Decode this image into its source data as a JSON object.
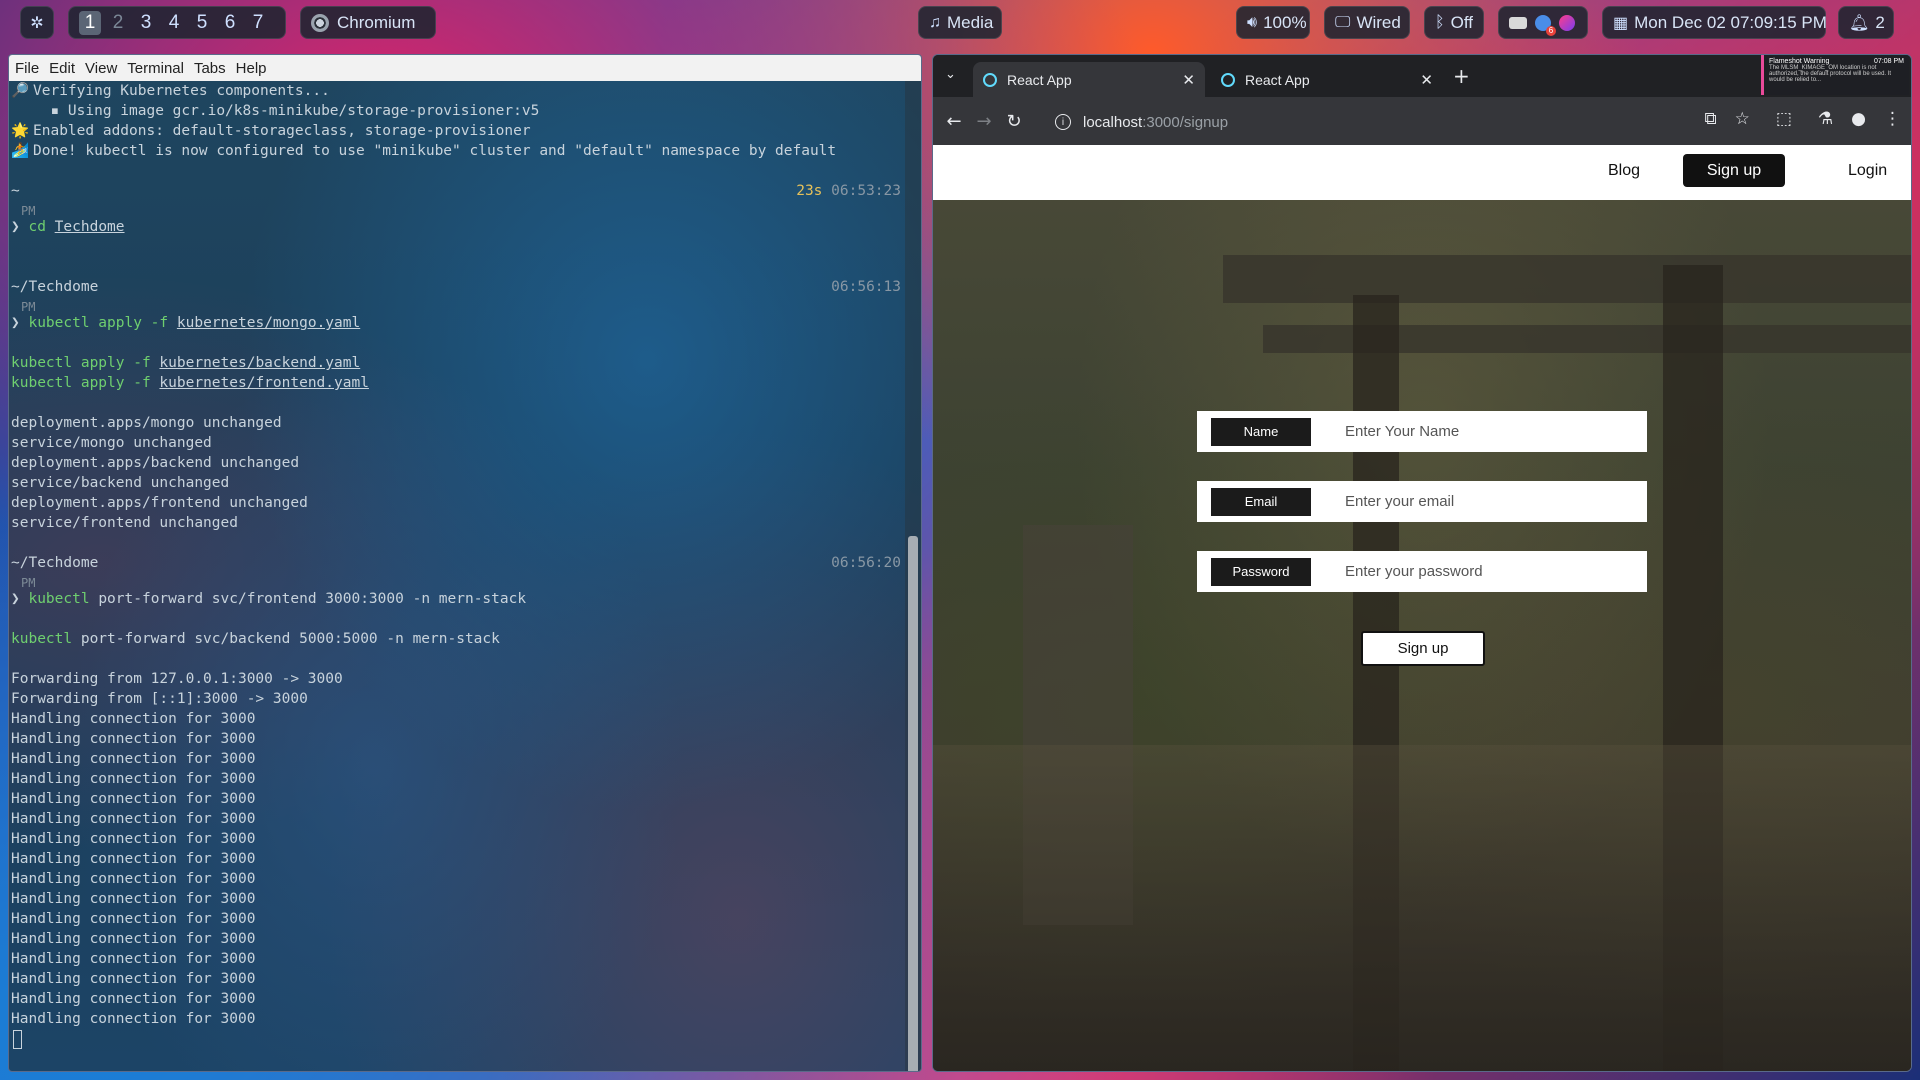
{
  "topbar": {
    "settings_icon": "gear-icon",
    "workspaces": [
      "1",
      "2",
      "3",
      "4",
      "5",
      "6",
      "7"
    ],
    "active_workspace": "1",
    "active_window": "Chromium",
    "media": "Media",
    "volume": "100%",
    "network": "Wired",
    "bluetooth": "Off",
    "datetime": "Mon Dec 02  07:09:15 PM",
    "notifications": "2",
    "tray_badge": "6"
  },
  "terminal": {
    "menu": [
      "File",
      "Edit",
      "View",
      "Terminal",
      "Tabs",
      "Help"
    ],
    "lines": [
      {
        "icon": "🔎",
        "text": "Verifying Kubernetes components..."
      },
      {
        "icon": "",
        "text": "  ▪ Using image gcr.io/k8s-minikube/storage-provisioner:v5"
      },
      {
        "icon": "🌟",
        "text": "Enabled addons: default-storageclass, storage-provisioner"
      },
      {
        "icon": "🏄",
        "text": "Done! kubectl is now configured to use \"minikube\" cluster and \"default\" namespace by default"
      }
    ],
    "prompt1": {
      "dir": "~",
      "duration": "23s",
      "time": "06:53:23",
      "ampm": "PM",
      "cmd": "cd",
      "arg": "Techdome"
    },
    "prompt2": {
      "dir": "~/Techdome",
      "time": "06:56:13",
      "ampm": "PM",
      "cmd": "kubectl apply -f",
      "arg": "kubernetes/mongo.yaml"
    },
    "apply_lines": [
      {
        "cmd": "kubectl apply -f",
        "arg": "kubernetes/backend.yaml"
      },
      {
        "cmd": "kubectl apply -f",
        "arg": "kubernetes/frontend.yaml"
      }
    ],
    "output1": [
      "deployment.apps/mongo unchanged",
      "service/mongo unchanged",
      "deployment.apps/backend unchanged",
      "service/backend unchanged",
      "deployment.apps/frontend unchanged",
      "service/frontend unchanged"
    ],
    "prompt3": {
      "dir": "~/Techdome",
      "time": "06:56:20",
      "ampm": "PM",
      "cmd": "kubectl",
      "arg": "port-forward svc/frontend 3000:3000 -n mern-stack"
    },
    "pf_backend": {
      "cmd": "kubectl",
      "arg": "port-forward svc/backend 5000:5000 -n mern-stack"
    },
    "forwarding": [
      "Forwarding from 127.0.0.1:3000 -> 3000",
      "Forwarding from [::1]:3000 -> 3000"
    ],
    "handling_line": "Handling connection for 3000",
    "handling_count": 16
  },
  "browser": {
    "tabs": [
      {
        "title": "React App",
        "active": true
      },
      {
        "title": "React App",
        "active": false
      }
    ],
    "url_host": "localhost",
    "url_path": ":3000/signup",
    "site_nav": {
      "blog": "Blog",
      "signup": "Sign up",
      "login": "Login"
    },
    "form": {
      "name_label": "Name",
      "name_placeholder": "Enter Your Name",
      "email_label": "Email",
      "email_placeholder": "Enter your email",
      "password_label": "Password",
      "password_placeholder": "Enter your password",
      "submit": "Sign up"
    },
    "notification": {
      "title": "Flameshot Warning",
      "time": "07:08 PM",
      "body": "The MLSM_KIMAGE_OM location is not authorized, the default protocol will be used. It would be relied to..."
    }
  }
}
